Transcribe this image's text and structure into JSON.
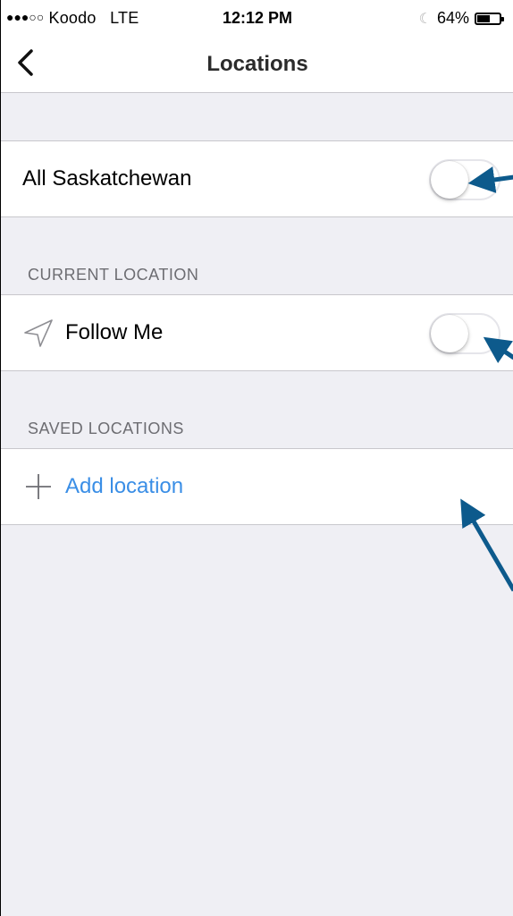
{
  "status_bar": {
    "signal_dots": "●●●○○",
    "carrier": "Koodo",
    "network": "LTE",
    "time": "12:12 PM",
    "battery_percent": "64%",
    "battery_level": 0.64
  },
  "nav": {
    "title": "Locations"
  },
  "all_region": {
    "label": "All Saskatchewan",
    "enabled": false
  },
  "current_location": {
    "header": "CURRENT LOCATION",
    "follow_me_label": "Follow Me",
    "enabled": false
  },
  "saved_locations": {
    "header": "SAVED LOCATIONS",
    "add_label": "Add location"
  },
  "colors": {
    "accent": "#3a8ee6",
    "annotation_arrow": "#0d5a8c",
    "background": "#efeff4"
  }
}
